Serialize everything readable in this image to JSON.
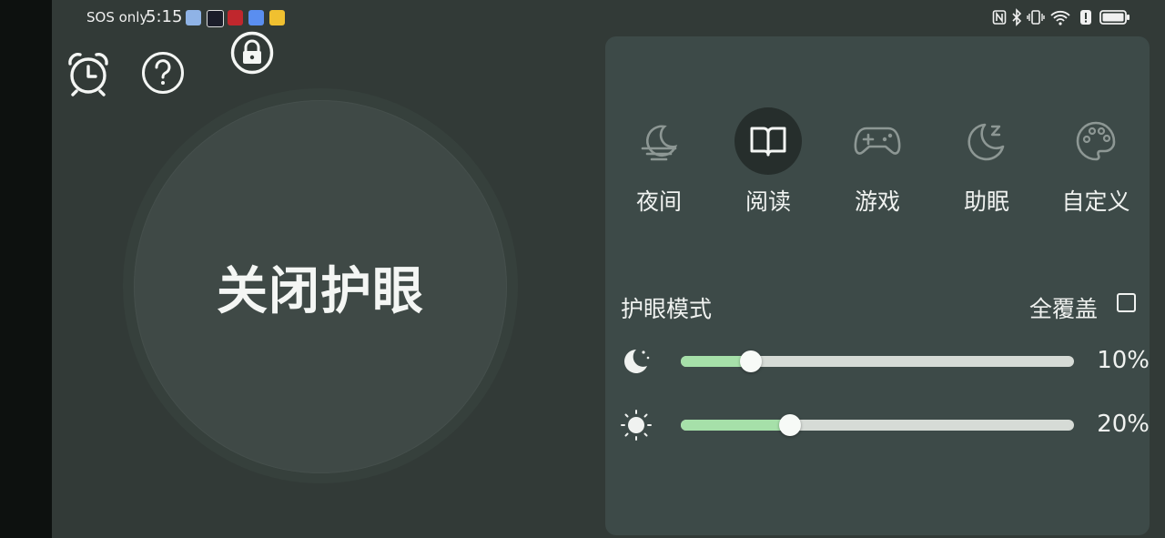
{
  "status_bar": {
    "carrier": "SOS only",
    "time": "5:15"
  },
  "top_icons": {
    "alarm": "alarm-clock-icon",
    "help": "question-icon",
    "lock": "lock-icon"
  },
  "main_button": {
    "label": "关闭护眼"
  },
  "modes": [
    {
      "label": "夜间",
      "icon": "night-moon-icon",
      "active": false
    },
    {
      "label": "阅读",
      "icon": "book-icon",
      "active": true
    },
    {
      "label": "游戏",
      "icon": "gamepad-icon",
      "active": false
    },
    {
      "label": "助眠",
      "icon": "sleep-moon-icon",
      "active": false
    },
    {
      "label": "自定义",
      "icon": "palette-icon",
      "active": false
    }
  ],
  "eye_mode": {
    "title": "护眼模式",
    "full_cover_label": "全覆盖",
    "full_cover_checked": false
  },
  "sliders": [
    {
      "icon": "moon-icon",
      "value": 10,
      "label": "10%"
    },
    {
      "icon": "sun-icon",
      "value": 20,
      "label": "20%"
    }
  ],
  "colors": {
    "accent": "#a6e0a9",
    "active_mode_bg": "#262e2c",
    "panel_bg": "#3d4a48"
  }
}
